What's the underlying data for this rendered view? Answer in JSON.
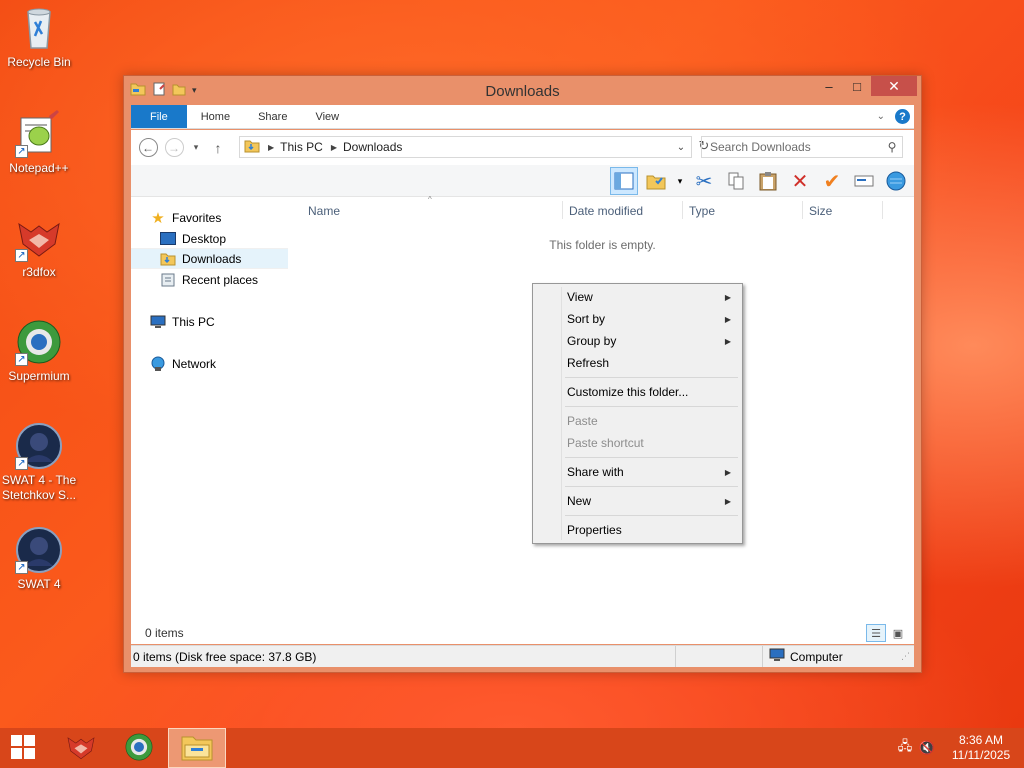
{
  "desktop": {
    "icons": [
      {
        "label": "Recycle Bin",
        "icon": "recycle-bin-icon"
      },
      {
        "label": "Notepad++",
        "icon": "notepad-plus-plus-icon"
      },
      {
        "label": "r3dfox",
        "icon": "r3dfox-icon"
      },
      {
        "label": "Supermium",
        "icon": "supermium-icon"
      },
      {
        "label": "SWAT 4 - The Stetchkov S...",
        "icon": "swat4-stetchkov-icon"
      },
      {
        "label": "SWAT 4",
        "icon": "swat4-icon"
      }
    ]
  },
  "window": {
    "title": "Downloads",
    "controls": {
      "minimize": "‒",
      "maximize": "□",
      "close": "✕"
    },
    "tabs": [
      "File",
      "Home",
      "Share",
      "View"
    ],
    "address": {
      "segments": [
        "This PC",
        "Downloads"
      ]
    },
    "search": {
      "placeholder": "Search Downloads"
    },
    "navpane": {
      "favorites": "Favorites",
      "items": [
        "Desktop",
        "Downloads",
        "Recent places"
      ],
      "this_pc": "This PC",
      "network": "Network"
    },
    "columns": [
      "Name",
      "Date modified",
      "Type",
      "Size"
    ],
    "empty_message": "This folder is empty.",
    "item_count": "0 items",
    "status": {
      "free_space": "0 items (Disk free space: 37.8 GB)",
      "location": "Computer"
    }
  },
  "context_menu": {
    "items": [
      {
        "label": "View",
        "submenu": true
      },
      {
        "label": "Sort by",
        "submenu": true
      },
      {
        "label": "Group by",
        "submenu": true
      },
      {
        "label": "Refresh"
      },
      {
        "label": "Customize this folder..."
      },
      {
        "label": "Paste",
        "disabled": true
      },
      {
        "label": "Paste shortcut",
        "disabled": true
      },
      {
        "label": "Share with",
        "submenu": true
      },
      {
        "label": "New",
        "submenu": true
      },
      {
        "label": "Properties"
      }
    ]
  },
  "taskbar": {
    "pinned": [
      "r3dfox-icon",
      "supermium-icon",
      "file-explorer-icon"
    ],
    "clock": {
      "time": "8:36 AM",
      "date": "11/11/2025"
    }
  },
  "colors": {
    "accent": "#1979ca",
    "window_frame": "#e9906a",
    "close_button": "#c7504a",
    "desktop": "#f24a12"
  }
}
